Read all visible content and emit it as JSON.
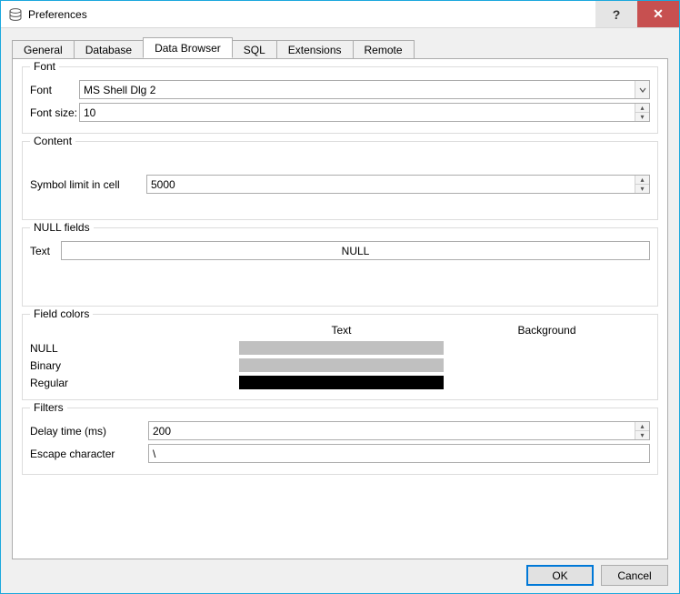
{
  "window": {
    "title": "Preferences"
  },
  "titlebar": {
    "help_symbol": "?",
    "close_symbol": "✕"
  },
  "tabs": {
    "items": [
      {
        "label": "General"
      },
      {
        "label": "Database"
      },
      {
        "label": "Data Browser"
      },
      {
        "label": "SQL"
      },
      {
        "label": "Extensions"
      },
      {
        "label": "Remote"
      }
    ],
    "active_index": 2
  },
  "groups": {
    "font": {
      "legend": "Font",
      "font_label": "Font",
      "font_value": "MS Shell Dlg 2",
      "size_label": "Font size:",
      "size_value": "10"
    },
    "content": {
      "legend": "Content",
      "symbol_limit_label": "Symbol limit in cell",
      "symbol_limit_value": "5000"
    },
    "null_fields": {
      "legend": "NULL fields",
      "text_label": "Text",
      "text_value": "NULL"
    },
    "field_colors": {
      "legend": "Field colors",
      "head_text": "Text",
      "head_bg": "Background",
      "rows": [
        {
          "label": "NULL"
        },
        {
          "label": "Binary"
        },
        {
          "label": "Regular"
        }
      ]
    },
    "filters": {
      "legend": "Filters",
      "delay_label": "Delay time (ms)",
      "delay_value": "200",
      "escape_label": "Escape character",
      "escape_value": "\\"
    }
  },
  "footer": {
    "ok": "OK",
    "cancel": "Cancel"
  }
}
